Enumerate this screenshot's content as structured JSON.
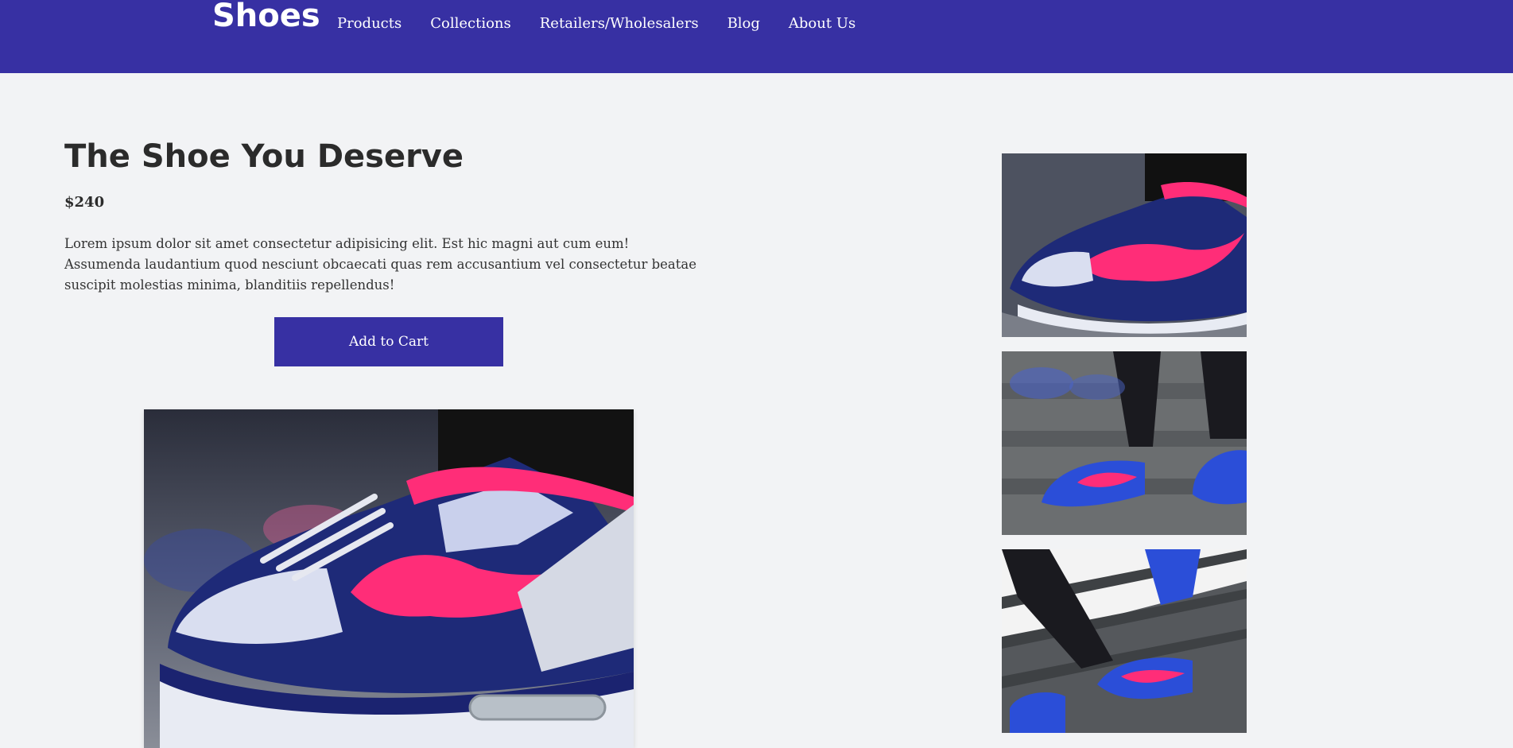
{
  "header": {
    "brand": "Shoes",
    "nav": [
      "Products",
      "Collections",
      "Retailers/Wholesalers",
      "Blog",
      "About Us"
    ]
  },
  "product": {
    "title": "The Shoe You Deserve",
    "price": "$240",
    "description": "Lorem ipsum dolor sit amet consectetur adipisicing elit. Est hic magni aut cum eum! Assumenda laudantium quod nesciunt obcaecati quas rem accusantium vel consectetur beatae suscipit molestias minima, blanditiis repellendus!",
    "add_to_cart_label": "Add to Cart"
  },
  "colors": {
    "brand": "#3730a3",
    "page_background": "#f2f3f5",
    "text": "#2b2b2b",
    "shoe_navy": "#1e2a78",
    "shoe_pink": "#ff2d78",
    "shoe_white": "#dde3f2"
  }
}
